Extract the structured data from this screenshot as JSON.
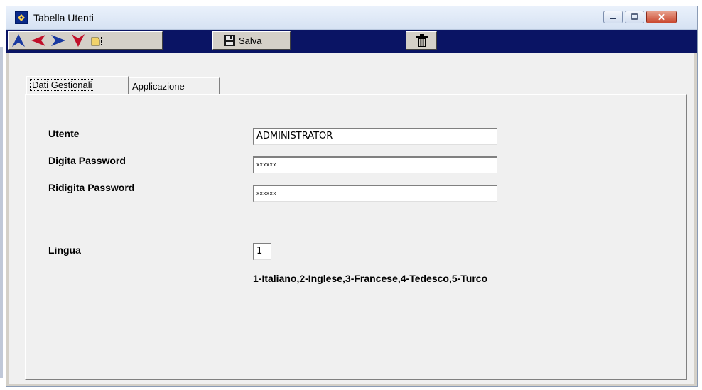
{
  "window": {
    "title": "Tabella Utenti"
  },
  "toolbar": {
    "nav_icons": [
      "arrow-up-icon",
      "arrow-left-icon",
      "arrow-right-icon",
      "arrow-down-icon",
      "find-icon"
    ],
    "save_label": "Salva",
    "save_icon": "floppy-disk-icon",
    "delete_icon": "trash-icon"
  },
  "tabs": [
    {
      "label": "Dati Gestionali",
      "active": true
    },
    {
      "label": "Applicazione",
      "active": false
    }
  ],
  "form": {
    "utente_label": "Utente",
    "utente_value": "ADMINISTRATOR",
    "password_label": "Digita Password",
    "password_value": "xxxxxx",
    "repassword_label": "Ridigita Password",
    "repassword_value": "xxxxxx",
    "lingua_label": "Lingua",
    "lingua_value": "1",
    "lingua_hint": "1-Italiano,2-Inglese,3-Francese,4-Tedesco,5-Turco"
  },
  "colors": {
    "toolbar_bg": "#0a1464",
    "nav_arrow_blue": "#1a3aa0",
    "nav_arrow_red": "#c0102a",
    "window_face": "#d4d0c8"
  }
}
